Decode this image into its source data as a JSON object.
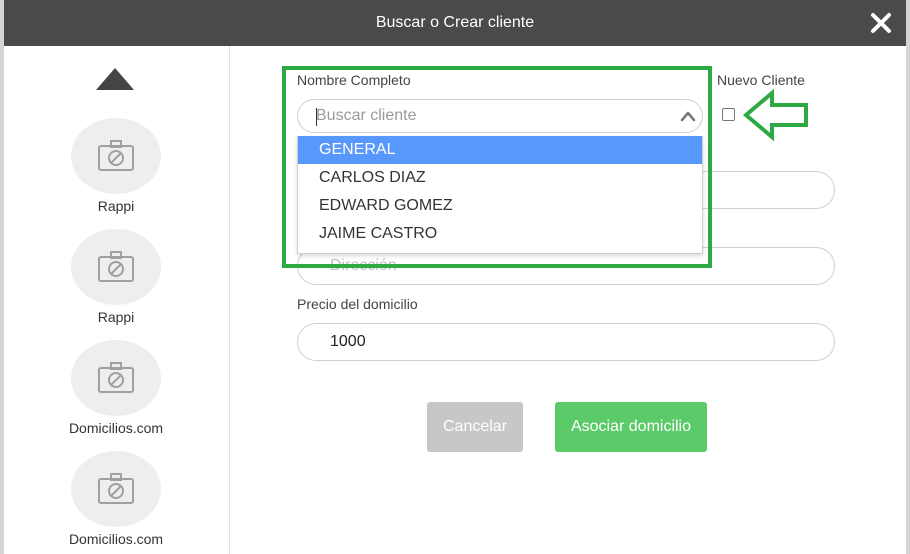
{
  "modal": {
    "title": "Buscar o Crear cliente"
  },
  "sidebar": {
    "providers": [
      {
        "name": "Rappi"
      },
      {
        "name": "Rappi"
      },
      {
        "name": "Domicilios.com"
      },
      {
        "name": "Domicilios.com"
      }
    ]
  },
  "form": {
    "nombre_label": "Nombre Completo",
    "search_placeholder": "Buscar cliente",
    "options": [
      "GENERAL",
      "CARLOS DIAZ",
      "EDWARD GOMEZ",
      "JAIME CASTRO"
    ],
    "selected_index": 0,
    "nuevo_cliente_label": "Nuevo Cliente",
    "nuevo_cliente_checked": false,
    "direccion_placeholder": "Dirección",
    "precio_label": "Precio del domicilio",
    "precio_value": "1000",
    "cancel_label": "Cancelar",
    "asociar_label": "Asociar domicilio"
  },
  "colors": {
    "header_bg": "#4a4a4a",
    "highlight": "#5897fb",
    "annotation_green": "#2eaa43",
    "primary_button": "#5bcb6a",
    "cancel_button": "#c7c7c7"
  },
  "icons": {
    "close": "close-icon",
    "scroll_up": "triangle-up-icon",
    "placeholder_image": "no-image-camera-icon",
    "select_open": "chevron-up-icon",
    "annotation_arrow": "left-arrow-icon"
  }
}
